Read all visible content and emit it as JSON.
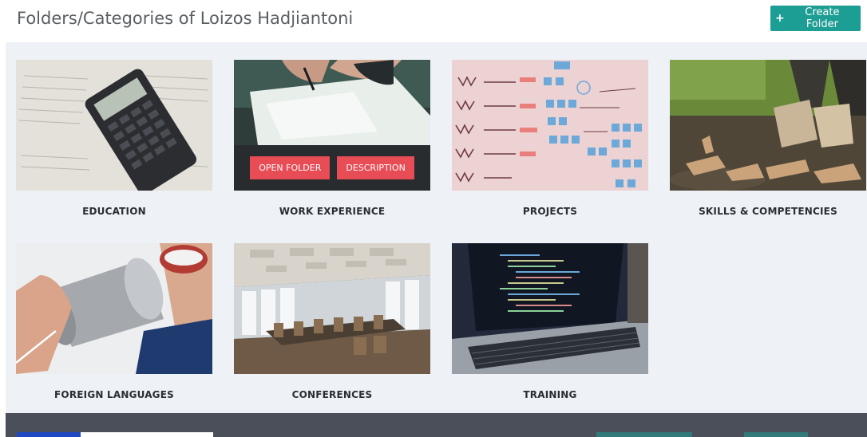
{
  "header": {
    "title": "Folders/Categories of Loizos Hadjiantoni",
    "create_button_label": "Create Folder",
    "create_button_icon": "plus-icon"
  },
  "colors": {
    "accent": "#1d9e94",
    "overlay_button": "#e84c55",
    "grid_background": "#eef1f6",
    "footer": "#4b4f5a"
  },
  "folders": [
    {
      "label": "EDUCATION"
    },
    {
      "label": "WORK EXPERIENCE",
      "actions": [
        "OPEN FOLDER",
        "DESCRIPTION"
      ]
    },
    {
      "label": "PROJECTS"
    },
    {
      "label": "SKILLS & COMPETENCIES"
    },
    {
      "label": "FOREIGN LANGUAGES"
    },
    {
      "label": "CONFERENCES"
    },
    {
      "label": "TRAINING"
    }
  ]
}
